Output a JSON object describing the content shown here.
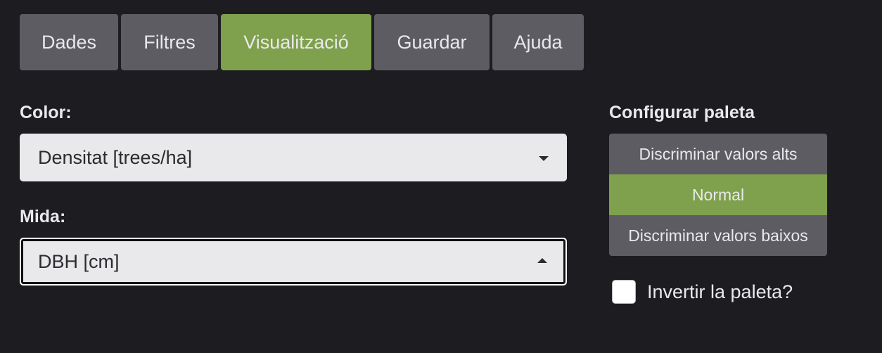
{
  "tabs": [
    {
      "label": "Dades",
      "active": false
    },
    {
      "label": "Filtres",
      "active": false
    },
    {
      "label": "Visualització",
      "active": true
    },
    {
      "label": "Guardar",
      "active": false
    },
    {
      "label": "Ajuda",
      "active": false
    }
  ],
  "color": {
    "label": "Color:",
    "value": "Densitat [trees/ha]"
  },
  "size": {
    "label": "Mida:",
    "value": "DBH [cm]"
  },
  "palette": {
    "title": "Configurar paleta",
    "options": [
      {
        "label": "Discriminar valors alts",
        "active": false
      },
      {
        "label": "Normal",
        "active": true
      },
      {
        "label": "Discriminar valors baixos",
        "active": false
      }
    ],
    "invert_label": "Invertir la paleta?",
    "invert_checked": false
  },
  "colors": {
    "background": "#1d1d21",
    "tab": "#5c5c62",
    "accent": "#7fa04c",
    "select_bg": "#e9e9ec"
  }
}
